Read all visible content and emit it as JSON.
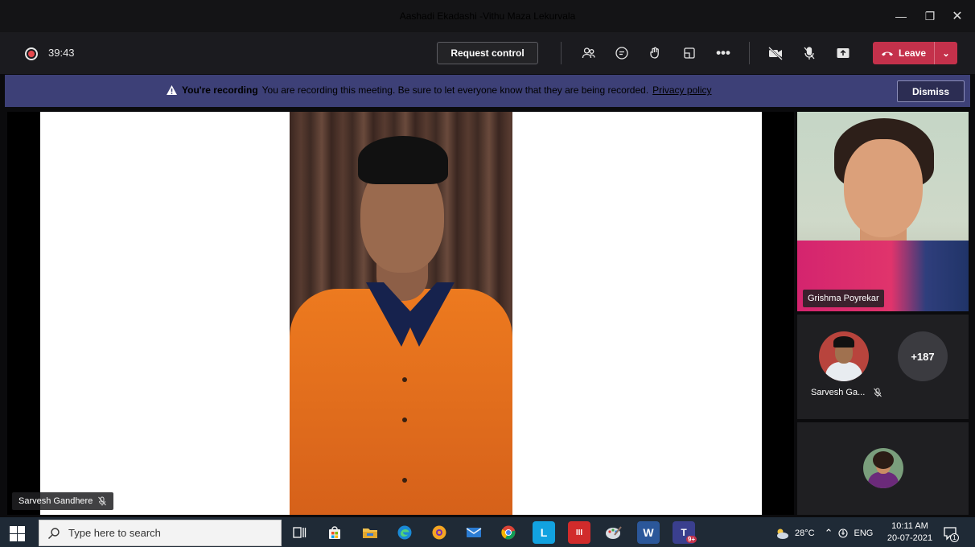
{
  "window": {
    "title": "Aashadi Ekadashi -Vithu Maza Lekurvala",
    "controls": [
      "minimize",
      "restore",
      "close"
    ]
  },
  "toolbar": {
    "timer": "39:43",
    "request_control_label": "Request control",
    "icons": [
      "people-icon",
      "chat-icon",
      "reactions-icon",
      "rooms-icon",
      "more-icon",
      "camera-off-icon",
      "mic-off-icon",
      "share-icon"
    ],
    "leave_label": "Leave",
    "leave_color": "#c4314b"
  },
  "banner": {
    "title": "You're recording",
    "message": "You are recording this meeting. Be sure to let everyone know that they are being recorded.",
    "privacy_link": "Privacy policy",
    "dismiss_label": "Dismiss",
    "background": "#3d4077"
  },
  "stage": {
    "main_participant": "Sarvesh Gandhere",
    "main_muted": true
  },
  "gallery": {
    "video_participant": "Grishma Poyrekar",
    "avatar_participant": "Sarvesh Ga...",
    "avatar_muted": true,
    "overflow_count": "+187"
  },
  "taskbar": {
    "search_placeholder": "Type here to search",
    "apps": [
      {
        "icon": "task-view-icon"
      },
      {
        "icon": "store-icon"
      },
      {
        "icon": "file-explorer-icon"
      },
      {
        "icon": "edge-icon"
      },
      {
        "icon": "brave-icon"
      },
      {
        "icon": "mail-icon"
      },
      {
        "icon": "chrome-icon"
      },
      {
        "icon": "l-app-icon",
        "label": "L"
      },
      {
        "icon": "red-app-icon",
        "label": "III"
      },
      {
        "icon": "paint-icon"
      },
      {
        "icon": "word-icon",
        "label": "W"
      },
      {
        "icon": "teams-icon",
        "label": "T",
        "badge": "9+"
      }
    ],
    "weather_temp": "28°C",
    "language": "ENG",
    "time": "10:11 AM",
    "date": "20-07-2021",
    "notification_count": "1"
  }
}
